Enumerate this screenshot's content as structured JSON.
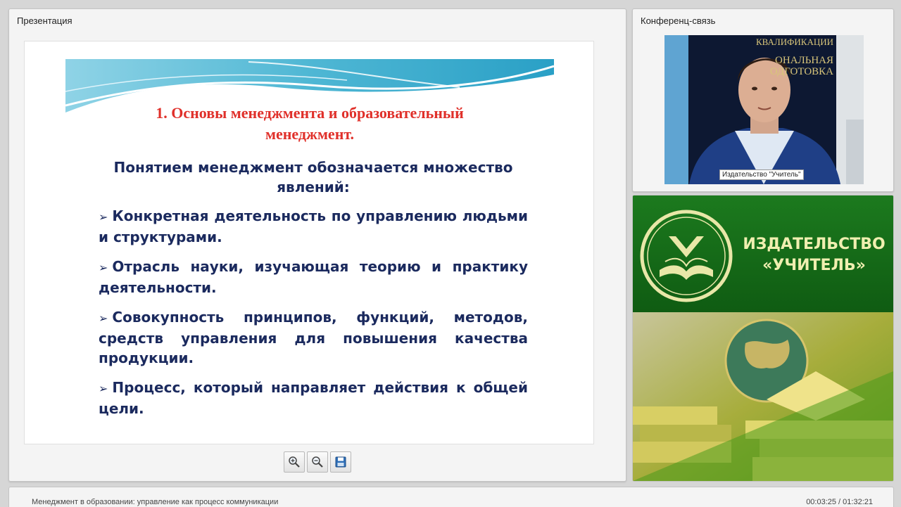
{
  "presentation_panel": {
    "title": "Презентация"
  },
  "slide": {
    "title_line1": "1. Основы менеджмента и образовательный",
    "title_line2": "менеджмент.",
    "subtitle": "Понятием менеджмент обозначается множество явлений:",
    "bullets": [
      "Конкретная деятельность по управлению людьми и структурами.",
      "Отрасль науки, изучающая теорию и практику деятельности.",
      "Совокупность принципов, функций, методов, средств управления для повышения качества продукции.",
      "Процесс, который направляет действия к общей цели."
    ],
    "bullet_icon": "arrowhead-icon",
    "title_color": "#e0302a",
    "text_color": "#1b2a5e"
  },
  "toolbar": {
    "icons": [
      "zoom-in-icon",
      "zoom-out-icon",
      "save-icon"
    ]
  },
  "conference_panel": {
    "title": "Конференц-связь",
    "video_caption": "Издательство \"Учитель\"",
    "background_text": [
      "КВАЛИФИКАЦИИ",
      "ОНАЛЬНАЯ",
      "ОДГОТОВКА"
    ]
  },
  "publisher_panel": {
    "name_line1": "ИЗДАТЕЛЬСТВО",
    "name_line2": "«УЧИТЕЛЬ»",
    "brand_color": "#1e7a1a",
    "text_color": "#f0efb0"
  },
  "status_bar": {
    "course_title": "Менеджмент в образовании: управление как процесс коммуникации",
    "timer": "00:03:25 / 01:32:21"
  }
}
